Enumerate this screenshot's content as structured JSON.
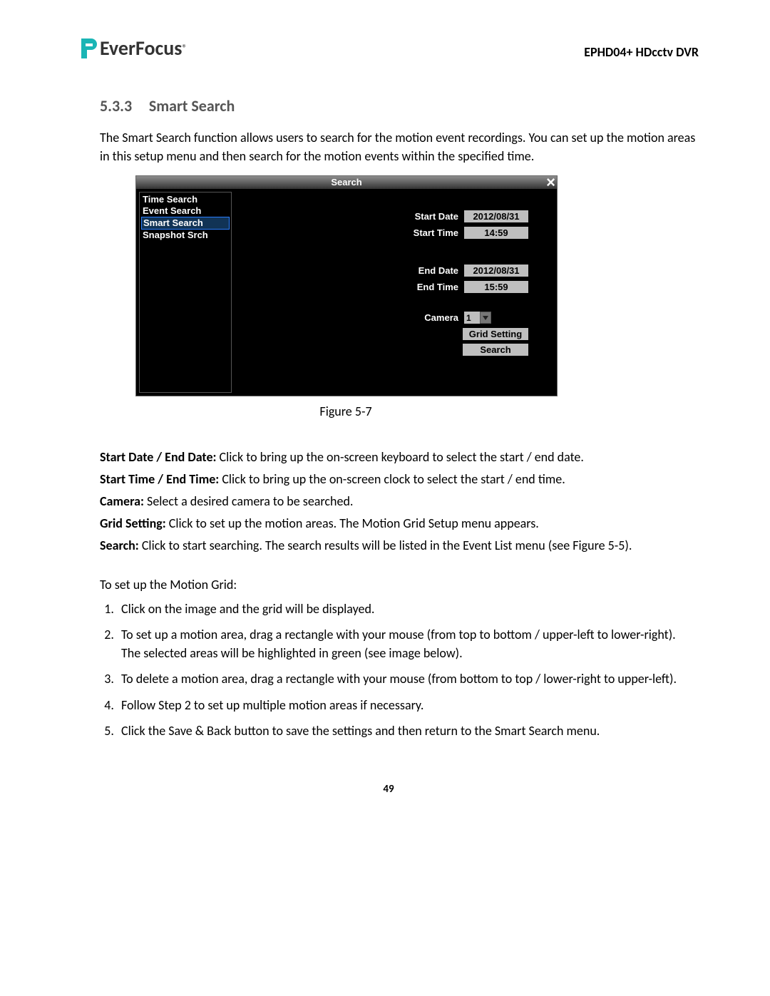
{
  "header": {
    "brand": "EverFocus",
    "product": "EPHD04+  HDcctv DVR"
  },
  "section": {
    "number": "5.3.3",
    "title": "Smart Search",
    "intro": "The Smart Search function allows users to search for the motion event recordings. You can set up the motion areas in this setup menu and then search for the motion events within the specified time."
  },
  "dvr": {
    "title": "Search",
    "side": [
      "Time Search",
      "Event Search",
      "Smart Search",
      "Snapshot Srch"
    ],
    "selected_index": 2,
    "labels": {
      "start_date": "Start Date",
      "start_time": "Start Time",
      "end_date": "End Date",
      "end_time": "End Time",
      "camera": "Camera"
    },
    "values": {
      "start_date": "2012/08/31",
      "start_time": "14:59",
      "end_date": "2012/08/31",
      "end_time": "15:59",
      "camera": "1"
    },
    "buttons": {
      "grid": "Grid Setting",
      "search": "Search"
    }
  },
  "figure_caption": "Figure 5-7",
  "defs": {
    "d1_label": "Start Date / End Date:",
    "d1_text": " Click to bring up the on-screen keyboard to select the start / end date.",
    "d2_label": "Start Time / End Time:",
    "d2_text": " Click to bring up the on-screen clock to select the start / end time.",
    "d3_label": "Camera:",
    "d3_text": " Select a desired camera to be searched.",
    "d4_label": "Grid Setting:",
    "d4_text": " Click to set up the motion areas. The Motion Grid Setup menu appears.",
    "d5_label": "Search:",
    "d5_text": " Click to start searching. The search results will be listed in the Event List menu (see Figure 5-5)."
  },
  "instructions": {
    "heading": "To set up the Motion Grid:",
    "steps": [
      "Click on the image and the grid will be displayed.",
      "To set up a motion area, drag a rectangle with your mouse (from top to bottom / upper-left to lower-right). The selected areas will be highlighted in green (see image below).",
      "To delete a motion area, drag a rectangle with your mouse (from bottom to top / lower-right to upper-left).",
      "Follow Step 2 to set up multiple motion areas if necessary.",
      "Click the Save & Back button to save the settings and then return to the Smart Search menu."
    ]
  },
  "page_number": "49"
}
